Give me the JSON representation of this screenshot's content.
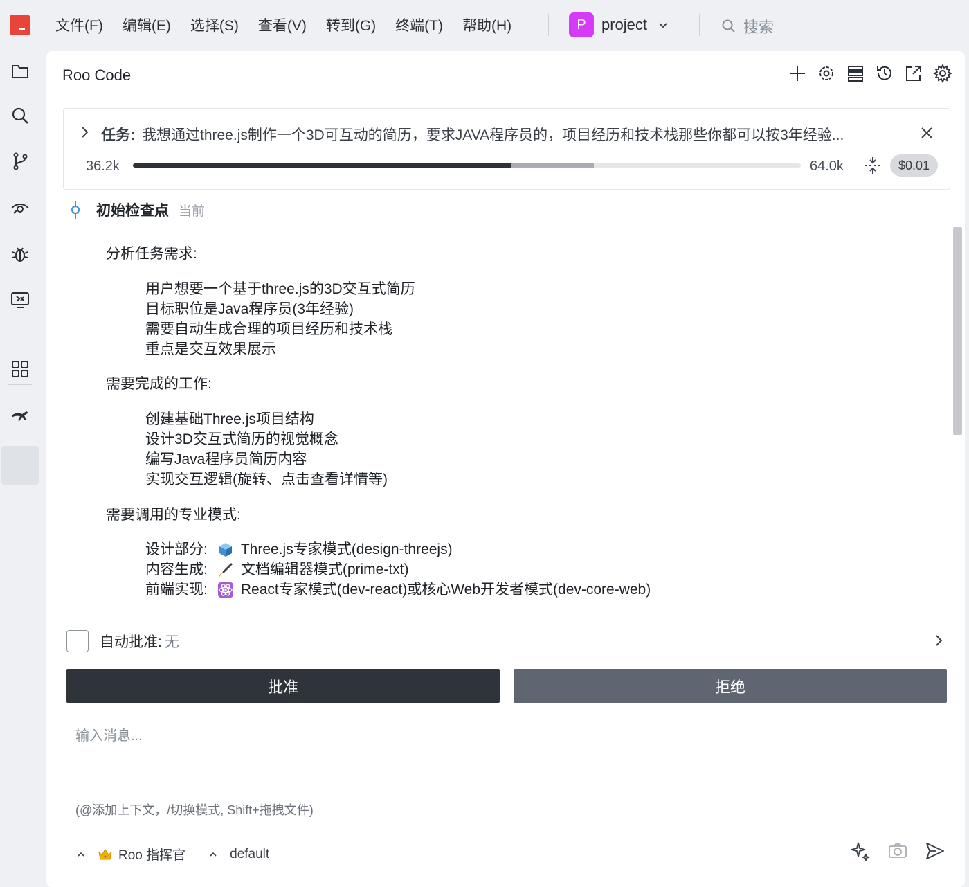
{
  "menubar": {
    "items": [
      "文件(F)",
      "编辑(E)",
      "选择(S)",
      "查看(V)",
      "转到(G)",
      "终端(T)",
      "帮助(H)"
    ],
    "project_badge": "P",
    "project_name": "project",
    "search_placeholder": "搜索"
  },
  "activity_bar": {
    "icons": [
      "folder-icon",
      "search-icon",
      "source-control-icon",
      "eye-icon",
      "debug-bug-icon",
      "remote-explorer-icon",
      "extensions-icon",
      "kangaroo-icon"
    ],
    "active": "kangaroo-icon"
  },
  "panel": {
    "title": "Roo Code",
    "toolbar_icons": [
      "plus-icon",
      "mcp-icon",
      "server-icon",
      "history-icon",
      "popout-icon",
      "settings-icon"
    ]
  },
  "task": {
    "label": "任务:",
    "text": "我想通过three.js制作一个3D可互动的简历，要求JAVA程序员的，项目经历和技术栈那些你都可以按3年经验...",
    "tokens_used": "36.2k",
    "context_window": "64.0k",
    "progress_used_fraction": 0.566,
    "progress_reserved_fraction": 0.69,
    "cost": "$0.01"
  },
  "checkpoint": {
    "title": "初始检查点",
    "tag": "当前"
  },
  "message": {
    "section1_title": "分析任务需求:",
    "section1_items": [
      "用户想要一个基于three.js的3D交互式简历",
      "目标职位是Java程序员(3年经验)",
      "需要自动生成合理的项目经历和技术栈",
      "重点是交互效果展示"
    ],
    "section2_title": "需要完成的工作:",
    "section2_items": [
      "创建基础Three.js项目结构",
      "设计3D交互式简历的视觉概念",
      "编写Java程序员简历内容",
      "实现交互逻辑(旋转、点击查看详情等)"
    ],
    "section3_title": "需要调用的专业模式:",
    "modes": [
      {
        "label": "设计部分:",
        "icon": "cube-emoji-icon",
        "text": "Three.js专家模式(design-threejs)"
      },
      {
        "label": "内容生成:",
        "icon": "fountain-pen-emoji-icon",
        "text": "文档编辑器模式(prime-txt)"
      },
      {
        "label": "前端实现:",
        "icon": "atom-emoji-icon",
        "text": "React专家模式(dev-react)或核心Web开发者模式(dev-core-web)"
      }
    ]
  },
  "auto_approve": {
    "label": "自动批准:",
    "value": "无"
  },
  "buttons": {
    "approve": "批准",
    "reject": "拒绝"
  },
  "input": {
    "placeholder": "输入消息...",
    "hint": "(@添加上下文，/切换模式, Shift+拖拽文件)"
  },
  "bottom_bar": {
    "mode_label": "Roo 指挥官",
    "profile_label": "default"
  },
  "colors": {
    "accent_logo": "#e8443a",
    "project_badge": "#d63af9",
    "approve_button": "#2f333a",
    "reject_button": "#5f6672",
    "checkpoint_icon": "#4a90d9"
  }
}
